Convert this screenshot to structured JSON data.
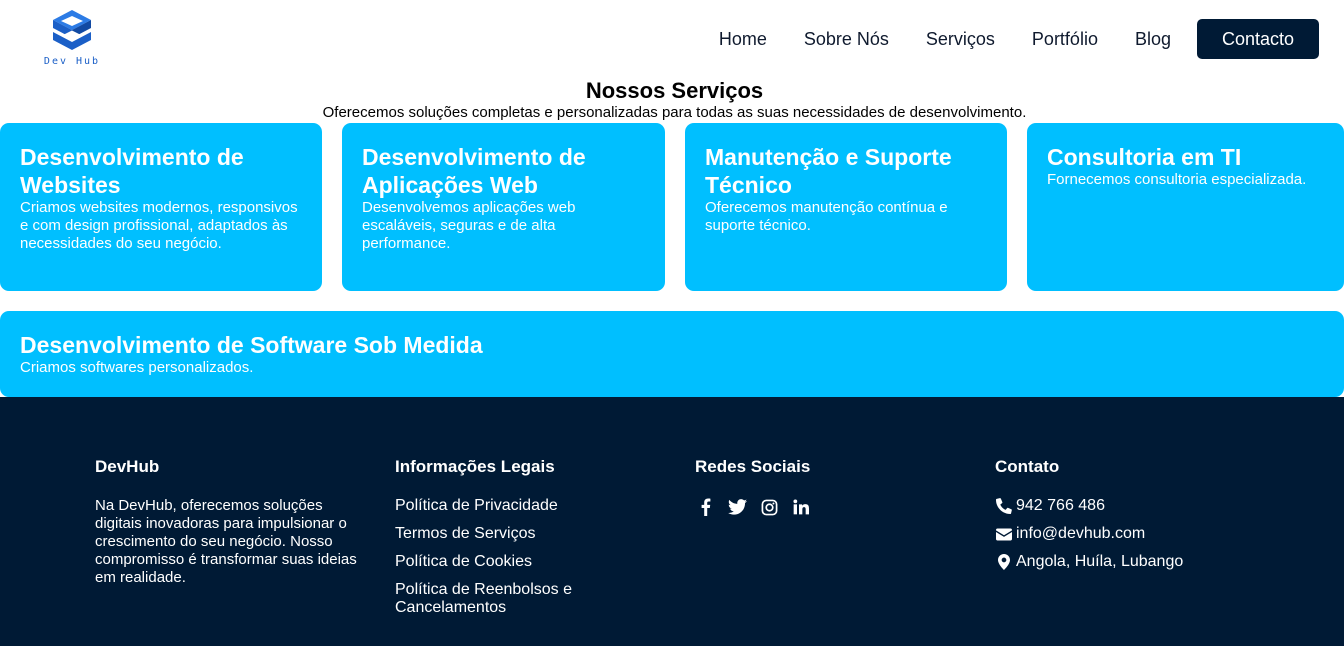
{
  "brand": {
    "logo_text": "Dev Hub",
    "logo_color": "#1b5fc7"
  },
  "nav": {
    "items": [
      "Home",
      "Sobre Nós",
      "Serviços",
      "Portfólio",
      "Blog"
    ],
    "cta": "Contacto"
  },
  "services": {
    "title": "Nossos Serviços",
    "subtitle": "Oferecemos soluções completas e personalizadas para todas as suas necessidades de desenvolvimento.",
    "cards": [
      {
        "title": "Desenvolvimento de Websites",
        "text": "Criamos websites modernos, responsivos e com design profissional, adaptados às necessidades do seu negócio."
      },
      {
        "title": "Desenvolvimento de Aplicações Web",
        "text": "Desenvolvemos aplicações web escaláveis, seguras e de alta performance."
      },
      {
        "title": "Manutenção e Suporte Técnico",
        "text": "Oferecemos manutenção contínua e suporte técnico."
      },
      {
        "title": "Consultoria em TI",
        "text": "Fornecemos consultoria especializada."
      },
      {
        "title": "Desenvolvimento de Software Sob Medida",
        "text": "Criamos softwares personalizados."
      }
    ],
    "card_color": "#00bfff"
  },
  "footer": {
    "about": {
      "title": "DevHub",
      "text": "Na DevHub, oferecemos soluções digitais inovadoras para impulsionar o crescimento do seu negócio. Nosso compromisso é transformar suas ideias em realidade."
    },
    "legal": {
      "title": "Informações Legais",
      "links": [
        "Política de Privacidade",
        "Termos de Serviços",
        "Política de Cookies",
        "Política de Reenbolsos e Cancelamentos"
      ]
    },
    "social": {
      "title": "Redes Sociais",
      "icons": [
        "facebook-icon",
        "twitter-icon",
        "instagram-icon",
        "linkedin-icon"
      ]
    },
    "contact": {
      "title": "Contato",
      "phone": "942 766 486",
      "email": "info@devhub.com",
      "location": "Angola, Huíla, Lubango"
    },
    "background": "#001a35"
  }
}
